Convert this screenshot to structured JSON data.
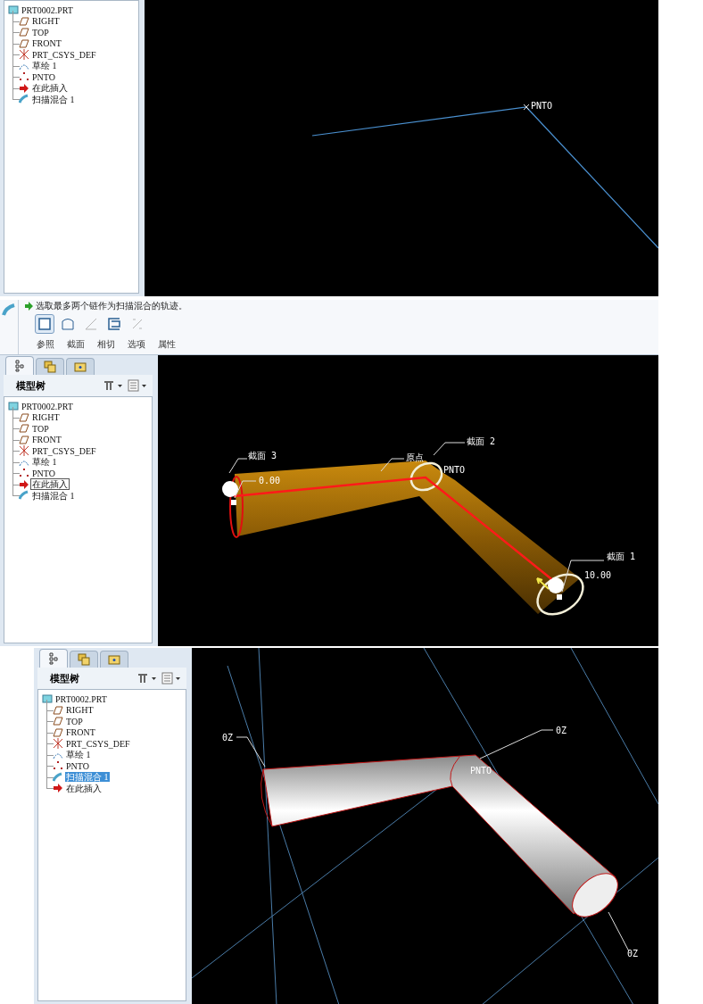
{
  "screen_1": {
    "model_tree": {
      "root": {
        "label": "PRT0002.PRT",
        "kind": "part",
        "children": [
          {
            "label": "RIGHT",
            "kind": "plane"
          },
          {
            "label": "TOP",
            "kind": "plane"
          },
          {
            "label": "FRONT",
            "kind": "plane"
          },
          {
            "label": "PRT_CSYS_DEF",
            "kind": "csys"
          },
          {
            "label": "草绘 1",
            "kind": "sketch"
          },
          {
            "label": "PNTO",
            "kind": "point"
          },
          {
            "label": "在此插入",
            "kind": "insert"
          },
          {
            "label": "扫描混合 1",
            "kind": "sweep"
          }
        ]
      }
    },
    "viewport": {
      "kind": "datum",
      "labels": [
        "PNTO"
      ]
    }
  },
  "screen_2": {
    "dashboard": {
      "message": "选取最多两个链作为扫描混合的轨迹。",
      "tools": [
        {
          "kind": "collector",
          "selected": true,
          "disabled": false
        },
        {
          "kind": "section",
          "selected": false,
          "disabled": false
        },
        {
          "kind": "tangent",
          "selected": false,
          "disabled": true
        },
        {
          "kind": "bracket",
          "selected": false,
          "disabled": false
        },
        {
          "kind": "percent",
          "selected": false,
          "disabled": true
        }
      ],
      "tabs": [
        "参照",
        "截面",
        "相切",
        "选项",
        "属性"
      ]
    },
    "nav_tabs": [
      {
        "kind": "tree",
        "selected": true
      },
      {
        "kind": "layers",
        "selected": false
      },
      {
        "kind": "folder",
        "selected": false
      }
    ],
    "model_tree": {
      "title": "模型树",
      "root": {
        "label": "PRT0002.PRT",
        "kind": "part",
        "selected": false,
        "children": [
          {
            "label": "RIGHT",
            "kind": "plane",
            "selected": false
          },
          {
            "label": "TOP",
            "kind": "plane",
            "selected": false
          },
          {
            "label": "FRONT",
            "kind": "plane",
            "selected": false
          },
          {
            "label": "PRT_CSYS_DEF",
            "kind": "csys",
            "selected": false
          },
          {
            "label": "草绘 1",
            "kind": "sketch",
            "selected": false
          },
          {
            "label": "PNTO",
            "kind": "point",
            "selected": false
          },
          {
            "label": "在此插入",
            "kind": "insert",
            "selected": true
          },
          {
            "label": "扫描混合 1",
            "kind": "sweep",
            "selected": false
          }
        ]
      }
    },
    "viewport": {
      "kind": "preview",
      "labels": [
        "截面 3",
        "0.00",
        "原点",
        "截面 2",
        "PNTO",
        "截面 1",
        "10.00"
      ]
    }
  },
  "screen_3": {
    "nav_tabs": [
      {
        "kind": "tree",
        "selected": true
      },
      {
        "kind": "layers",
        "selected": false
      },
      {
        "kind": "folder",
        "selected": false
      }
    ],
    "model_tree": {
      "title": "模型树",
      "root": {
        "label": "PRT0002.PRT",
        "kind": "part",
        "selected": false,
        "children": [
          {
            "label": "RIGHT",
            "kind": "plane",
            "selected": false
          },
          {
            "label": "TOP",
            "kind": "plane",
            "selected": false
          },
          {
            "label": "FRONT",
            "kind": "plane",
            "selected": false
          },
          {
            "label": "PRT_CSYS_DEF",
            "kind": "csys",
            "selected": false
          },
          {
            "label": "草绘 1",
            "kind": "sketch",
            "selected": false
          },
          {
            "label": "PNTO",
            "kind": "point",
            "selected": false
          },
          {
            "label": "扫描混合 1",
            "kind": "sweep",
            "selected": true
          },
          {
            "label": "在此插入",
            "kind": "insert",
            "selected": false
          }
        ]
      }
    },
    "viewport": {
      "kind": "solid",
      "labels": [
        "0Z",
        "0Z",
        "PNTO",
        "0Z"
      ]
    }
  }
}
